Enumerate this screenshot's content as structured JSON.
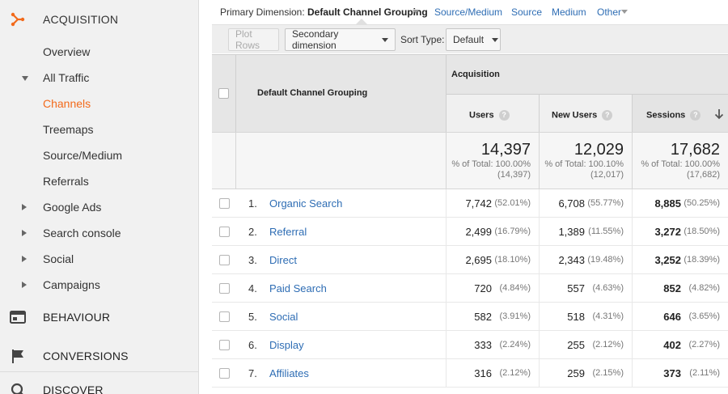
{
  "sidebar": {
    "sections": {
      "acquisition": "ACQUISITION",
      "behaviour": "BEHAVIOUR",
      "conversions": "CONVERSIONS",
      "discover": "DISCOVER"
    },
    "items": [
      {
        "label": "Overview",
        "state": "none"
      },
      {
        "label": "All Traffic",
        "state": "expanded"
      },
      {
        "label": "Channels",
        "state": "current"
      },
      {
        "label": "Treemaps",
        "state": "child"
      },
      {
        "label": "Source/Medium",
        "state": "child"
      },
      {
        "label": "Referrals",
        "state": "child"
      },
      {
        "label": "Google Ads",
        "state": "collapsed"
      },
      {
        "label": "Search console",
        "state": "collapsed"
      },
      {
        "label": "Social",
        "state": "collapsed"
      },
      {
        "label": "Campaigns",
        "state": "collapsed"
      }
    ],
    "accent_color": "#f26a1b"
  },
  "primary_dimension": {
    "label": "Primary Dimension:",
    "value": "Default Channel Grouping",
    "links": [
      "Source/Medium",
      "Source",
      "Medium",
      "Other"
    ]
  },
  "toolbar": {
    "plot_rows": "Plot Rows",
    "secondary_dimension": "Secondary dimension",
    "sort_type_label": "Sort Type:",
    "sort_type_value": "Default"
  },
  "table": {
    "group_header": "Acquisition",
    "dimension_header": "Default Channel Grouping",
    "columns": [
      "Users",
      "New Users",
      "Sessions"
    ],
    "help_icon": "?",
    "totals": [
      {
        "value": "14,397",
        "line1": "% of Total: 100.00%",
        "line2": "(14,397)"
      },
      {
        "value": "12,029",
        "line1": "% of Total: 100.10%",
        "line2": "(12,017)"
      },
      {
        "value": "17,682",
        "line1": "% of Total: 100.00%",
        "line2": "(17,682)"
      }
    ],
    "rows": [
      {
        "num": "1.",
        "name": "Organic Search",
        "users": "7,742",
        "users_pct": "(52.01%)",
        "new_users": "6,708",
        "new_users_pct": "(55.77%)",
        "sessions": "8,885",
        "sessions_pct": "(50.25%)"
      },
      {
        "num": "2.",
        "name": "Referral",
        "users": "2,499",
        "users_pct": "(16.79%)",
        "new_users": "1,389",
        "new_users_pct": "(11.55%)",
        "sessions": "3,272",
        "sessions_pct": "(18.50%)"
      },
      {
        "num": "3.",
        "name": "Direct",
        "users": "2,695",
        "users_pct": "(18.10%)",
        "new_users": "2,343",
        "new_users_pct": "(19.48%)",
        "sessions": "3,252",
        "sessions_pct": "(18.39%)"
      },
      {
        "num": "4.",
        "name": "Paid Search",
        "users": "720",
        "users_pct": "(4.84%)",
        "new_users": "557",
        "new_users_pct": "(4.63%)",
        "sessions": "852",
        "sessions_pct": "(4.82%)"
      },
      {
        "num": "5.",
        "name": "Social",
        "users": "582",
        "users_pct": "(3.91%)",
        "new_users": "518",
        "new_users_pct": "(4.31%)",
        "sessions": "646",
        "sessions_pct": "(3.65%)"
      },
      {
        "num": "6.",
        "name": "Display",
        "users": "333",
        "users_pct": "(2.24%)",
        "new_users": "255",
        "new_users_pct": "(2.12%)",
        "sessions": "402",
        "sessions_pct": "(2.27%)"
      },
      {
        "num": "7.",
        "name": "Affiliates",
        "users": "316",
        "users_pct": "(2.12%)",
        "new_users": "259",
        "new_users_pct": "(2.15%)",
        "sessions": "373",
        "sessions_pct": "(2.11%)"
      }
    ]
  }
}
